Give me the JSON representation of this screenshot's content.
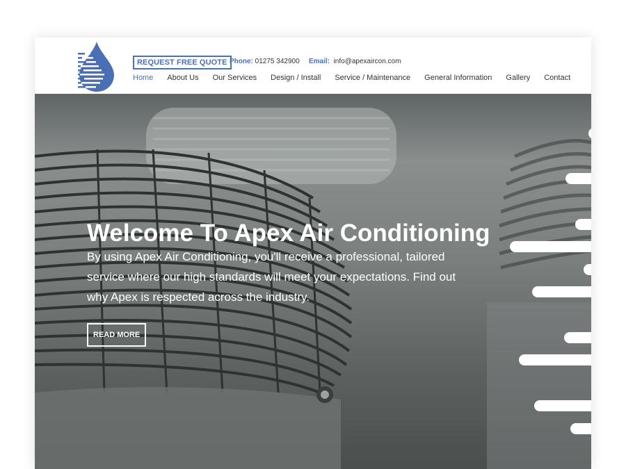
{
  "header": {
    "quote_button": "REQUEST FREE QUOTE",
    "phone_label": "Phone:",
    "phone_value": "01275 342900",
    "email_label": "Email:",
    "email_value": "info@apexaircon.com"
  },
  "nav": {
    "items": [
      {
        "label": "Home",
        "active": true
      },
      {
        "label": "About Us"
      },
      {
        "label": "Our Services"
      },
      {
        "label": "Design / Install"
      },
      {
        "label": "Service / Maintenance"
      },
      {
        "label": "General Information"
      },
      {
        "label": "Gallery"
      },
      {
        "label": "Contact"
      }
    ]
  },
  "hero": {
    "title": "Welcome To Apex Air Conditioning",
    "text": "By using Apex Air Conditioning, you'll receive a professional, tailored service where our high standards will meet your expectations. Find out why Apex is respected across the industry.",
    "button": "READ MORE"
  },
  "colors": {
    "accent": "#4a6fb5",
    "hero_text": "#ffffff"
  },
  "icons": {
    "logo": "water-drop-logo-icon"
  }
}
